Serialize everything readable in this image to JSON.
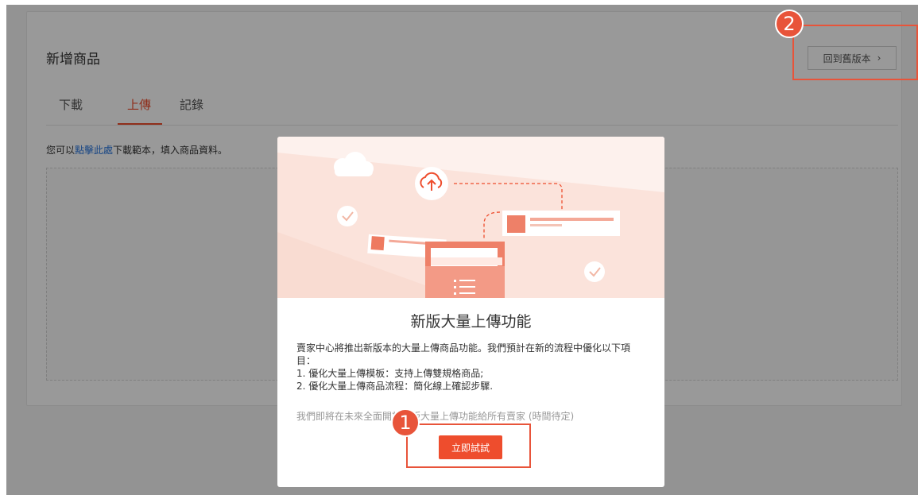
{
  "page": {
    "title": "新增商品",
    "old_version_button": "回到舊版本",
    "tabs": [
      "下載",
      "上傳",
      "記錄"
    ],
    "active_tab": "上傳",
    "hint_before": "您可以",
    "hint_link": "點擊此處",
    "hint_after": "下載範本，填入商品資料。"
  },
  "modal": {
    "title": "新版大量上傳功能",
    "body_line1": "賣家中心將推出新版本的大量上傳商品功能。我們預計在新的流程中優化以下項目：",
    "body_item1": "1. 優化大量上傳模板：支持上傳雙規格商品;",
    "body_item2": "2. 優化大量上傳商品流程：簡化線上確認步驟.",
    "note": "我們即將在未來全面開放新版大量上傳功能給所有賣家 (時間待定)",
    "try_button": "立即試試"
  },
  "annotations": {
    "badge1": "1",
    "badge2": "2"
  },
  "colors": {
    "accent": "#ee4d2d",
    "annotation": "#e8543a",
    "link": "#2673dd"
  }
}
